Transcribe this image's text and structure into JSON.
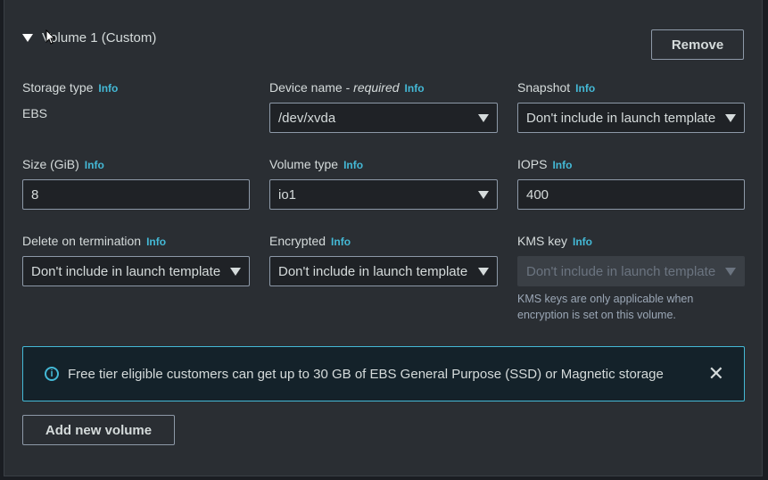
{
  "volume": {
    "title": "Volume 1 (Custom)",
    "remove_label": "Remove",
    "info_label": "Info",
    "storage_type": {
      "label": "Storage type",
      "value": "EBS"
    },
    "device_name": {
      "label": "Device name - ",
      "required": "required",
      "value": "/dev/xvda"
    },
    "snapshot": {
      "label": "Snapshot",
      "value": "Don't include in launch template"
    },
    "size": {
      "label": "Size (GiB)",
      "value": "8"
    },
    "volume_type": {
      "label": "Volume type",
      "value": "io1"
    },
    "iops": {
      "label": "IOPS",
      "value": "400"
    },
    "delete_on_termination": {
      "label": "Delete on termination",
      "value": "Don't include in launch template"
    },
    "encrypted": {
      "label": "Encrypted",
      "value": "Don't include in launch template"
    },
    "kms_key": {
      "label": "KMS key",
      "value": "Don't include in launch template",
      "help": "KMS keys are only applicable when encryption is set on this volume."
    }
  },
  "alert": {
    "text": "Free tier eligible customers can get up to 30 GB of EBS General Purpose (SSD) or Magnetic storage",
    "icon": "info-circle-icon"
  },
  "add_volume_label": "Add new volume",
  "colors": {
    "accent": "#44b9d6",
    "panel": "#2a2e33",
    "border": "#8d99a8"
  }
}
